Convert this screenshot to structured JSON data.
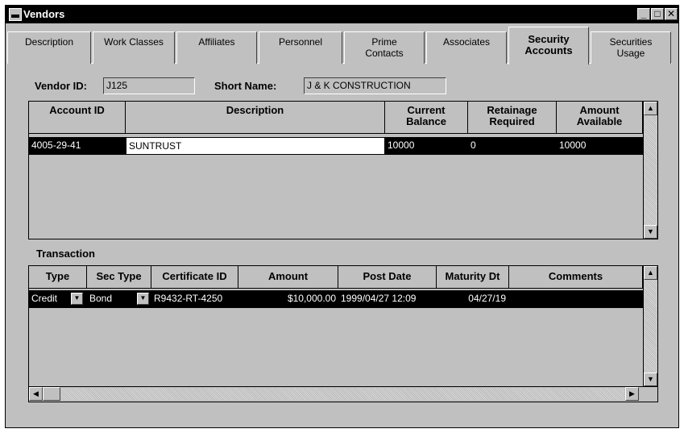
{
  "window": {
    "title": "Vendors",
    "min": "_",
    "max": "□",
    "close": "✕"
  },
  "tabs": [
    {
      "label": "Description"
    },
    {
      "label": "Work Classes"
    },
    {
      "label": "Affiliates"
    },
    {
      "label": "Personnel"
    },
    {
      "label": "Prime\nContacts"
    },
    {
      "label": "Associates"
    },
    {
      "label": "Security\nAccounts",
      "active": true
    },
    {
      "label": "Securities\nUsage"
    }
  ],
  "vendor": {
    "id_label": "Vendor ID:",
    "id_value": "J125",
    "short_name_label": "Short Name:",
    "short_name_value": "J & K CONSTRUCTION"
  },
  "accounts": {
    "columns": [
      "Account ID",
      "Description",
      "Current\nBalance",
      "Retainage\nRequired",
      "Amount\nAvailable"
    ],
    "rows": [
      {
        "account_id": "4005-29-41",
        "description": "SUNTRUST",
        "current_balance": "10000",
        "retainage_required": "0",
        "amount_available": "10000"
      }
    ]
  },
  "transaction": {
    "label": "Transaction",
    "columns": [
      "Type",
      "Sec Type",
      "Certificate ID",
      "Amount",
      "Post Date",
      "Maturity Dt",
      "Comments"
    ],
    "rows": [
      {
        "type": "Credit",
        "sec_type": "Bond",
        "certificate_id": "R9432-RT-4250",
        "amount": "$10,000.00",
        "post_date": "1999/04/27 12:09",
        "maturity_dt": "04/27/19",
        "comments": ""
      }
    ]
  },
  "icons": {
    "scroll_up": "▲",
    "scroll_down": "▼",
    "scroll_left": "◀",
    "scroll_right": "▶",
    "dropdown": "▼"
  }
}
